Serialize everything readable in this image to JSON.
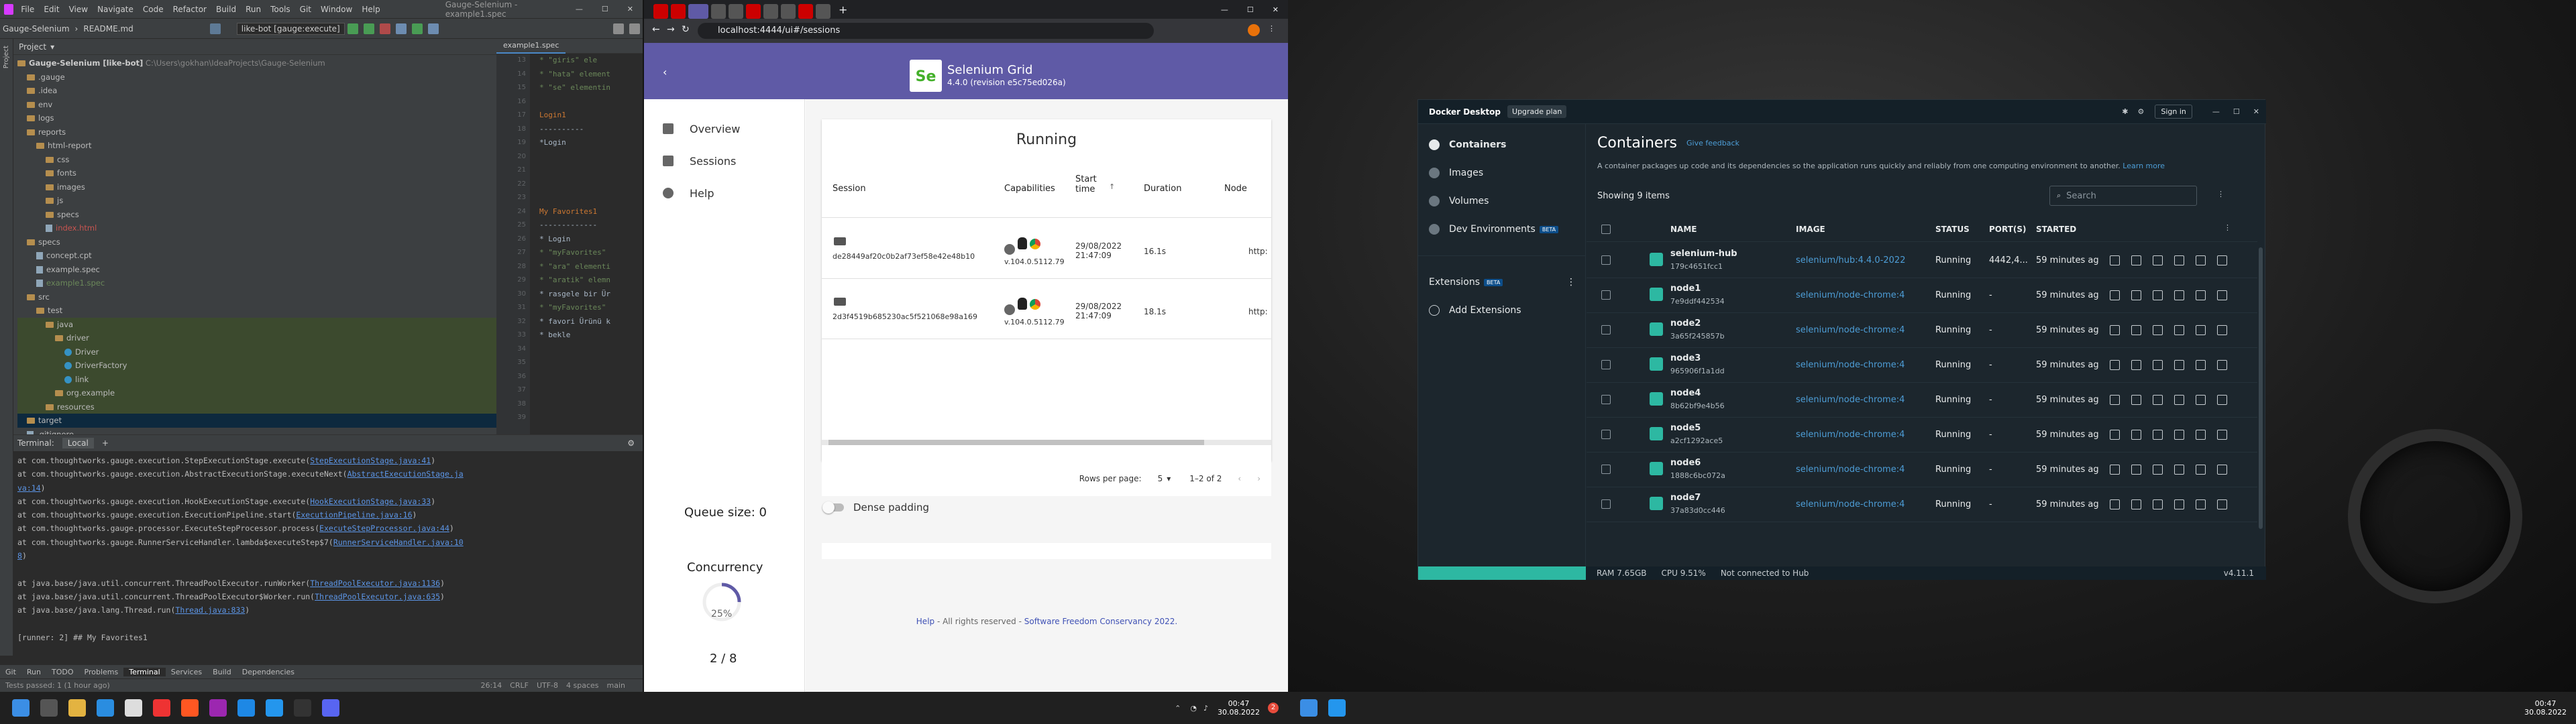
{
  "ide": {
    "app_title": "Gauge-Selenium - example1.spec",
    "menu": [
      "File",
      "Edit",
      "View",
      "Navigate",
      "Code",
      "Refactor",
      "Build",
      "Run",
      "Tools",
      "Git",
      "Window",
      "Help"
    ],
    "breadcrumb": [
      "Gauge-Selenium",
      "README.md"
    ],
    "run_config": "like-bot [gauge:execute]",
    "project_label": "Project",
    "root_label": "Gauge-Selenium [like-bot]",
    "root_path": "C:\\Users\\gokhan\\IdeaProjects\\Gauge-Selenium",
    "tree": [
      {
        "label": ".gauge",
        "type": "fold",
        "indent": 1
      },
      {
        "label": ".idea",
        "type": "fold",
        "indent": 1
      },
      {
        "label": "env",
        "type": "fold",
        "indent": 1
      },
      {
        "label": "logs",
        "type": "fold",
        "indent": 1
      },
      {
        "label": "reports",
        "type": "fold",
        "indent": 1
      },
      {
        "label": "html-report",
        "type": "fold",
        "indent": 2
      },
      {
        "label": "css",
        "type": "fold",
        "indent": 3
      },
      {
        "label": "fonts",
        "type": "fold",
        "indent": 3
      },
      {
        "label": "images",
        "type": "fold",
        "indent": 3
      },
      {
        "label": "js",
        "type": "fold",
        "indent": 3
      },
      {
        "label": "specs",
        "type": "fold",
        "indent": 3
      },
      {
        "label": "index.html",
        "type": "file",
        "indent": 3
      },
      {
        "label": "specs",
        "type": "fold",
        "indent": 1
      },
      {
        "label": "concept.cpt",
        "type": "file",
        "indent": 2
      },
      {
        "label": "example.spec",
        "type": "file",
        "indent": 2
      },
      {
        "label": "example1.spec",
        "type": "file",
        "indent": 2
      },
      {
        "label": "src",
        "type": "fold",
        "indent": 1
      },
      {
        "label": "test",
        "type": "fold",
        "indent": 2
      },
      {
        "label": "java",
        "type": "fold",
        "indent": 3,
        "hl": true
      },
      {
        "label": "driver",
        "type": "fold",
        "indent": 4,
        "hl": true
      },
      {
        "label": "Driver",
        "type": "cls",
        "indent": 5,
        "hl": true
      },
      {
        "label": "DriverFactory",
        "type": "cls",
        "indent": 5,
        "hl": true
      },
      {
        "label": "link",
        "type": "cls",
        "indent": 5,
        "hl": true
      },
      {
        "label": "org.example",
        "type": "fold",
        "indent": 4,
        "hl": true
      },
      {
        "label": "resources",
        "type": "fold",
        "indent": 3,
        "hl": true
      },
      {
        "label": "target",
        "type": "fold",
        "indent": 1,
        "sel": true
      },
      {
        "label": ".gitignore",
        "type": "file",
        "indent": 1
      }
    ],
    "editor_tab": "example1.spec",
    "gutter": [
      "13",
      "14",
      "15",
      "16",
      "17",
      "18",
      "19",
      "20",
      "21",
      "22",
      "23",
      "24",
      "25",
      "26",
      "27",
      "28",
      "29",
      "30",
      "31",
      "32",
      "33",
      "34",
      "35",
      "36",
      "37",
      "38",
      "39"
    ],
    "code": [
      {
        "t": "* \"giris\" ele",
        "c": "s"
      },
      {
        "t": "* \"hata\" element",
        "c": "s"
      },
      {
        "t": "* \"se\" elementin",
        "c": "s"
      },
      {
        "t": "",
        "c": ""
      },
      {
        "t": "Login1",
        "c": "h"
      },
      {
        "t": "----------",
        "c": ""
      },
      {
        "t": "*Login",
        "c": ""
      },
      {
        "t": "",
        "c": ""
      },
      {
        "t": "",
        "c": ""
      },
      {
        "t": "",
        "c": ""
      },
      {
        "t": "",
        "c": ""
      },
      {
        "t": "My Favorites1",
        "c": "h"
      },
      {
        "t": "-------------",
        "c": ""
      },
      {
        "t": "* Login",
        "c": ""
      },
      {
        "t": "* \"myFavorites\"",
        "c": "s"
      },
      {
        "t": "* \"ara\" elementi",
        "c": "s"
      },
      {
        "t": "* \"aratik\" elemn",
        "c": "s"
      },
      {
        "t": "* rasgele bir Ür",
        "c": ""
      },
      {
        "t": "* \"myFavorites\"",
        "c": "s"
      },
      {
        "t": "* favori Ürünü k",
        "c": ""
      },
      {
        "t": "* bekle",
        "c": ""
      }
    ],
    "terminal_tabs": [
      "Terminal:",
      "Local",
      "+"
    ],
    "terminal": [
      {
        "pre": "    at com.thoughtworks.gauge.execution.StepExecutionStage.execute(",
        "link": "StepExecutionStage.java:41",
        "post": ")"
      },
      {
        "pre": "    at com.thoughtworks.gauge.execution.AbstractExecutionStage.executeNext(",
        "link": "AbstractExecutionStage.ja",
        "post": ""
      },
      {
        "pre": "",
        "link": "va:14",
        "post": ")"
      },
      {
        "pre": "    at com.thoughtworks.gauge.execution.HookExecutionStage.execute(",
        "link": "HookExecutionStage.java:33",
        "post": ")"
      },
      {
        "pre": "    at com.thoughtworks.gauge.execution.ExecutionPipeline.start(",
        "link": "ExecutionPipeline.java:16",
        "post": ")"
      },
      {
        "pre": "    at com.thoughtworks.gauge.processor.ExecuteStepProcessor.process(",
        "link": "ExecuteStepProcessor.java:44",
        "post": ")"
      },
      {
        "pre": "    at com.thoughtworks.gauge.RunnerServiceHandler.lambda$executeStep$7(",
        "link": "RunnerServiceHandler.java:10",
        "post": ""
      },
      {
        "pre": "",
        "link": "8",
        "post": ")"
      },
      {
        "pre": "",
        "link": "",
        "post": ""
      },
      {
        "pre": "    at java.base/java.util.concurrent.ThreadPoolExecutor.runWorker(",
        "link": "ThreadPoolExecutor.java:1136",
        "post": ")"
      },
      {
        "pre": "    at java.base/java.util.concurrent.ThreadPoolExecutor$Worker.run(",
        "link": "ThreadPoolExecutor.java:635",
        "post": ")"
      },
      {
        "pre": "    at java.base/java.lang.Thread.run(",
        "link": "Thread.java:833",
        "post": ")"
      },
      {
        "pre": "",
        "link": "",
        "post": ""
      },
      {
        "pre": "[runner: 2]  ## My Favorites1",
        "link": "",
        "post": ""
      }
    ],
    "bottom_tabs": [
      "Git",
      "Run",
      "TODO",
      "Problems",
      "Terminal",
      "Services",
      "Build",
      "Dependencies"
    ],
    "status_left": "Tests passed: 1 (1 hour ago)",
    "status_right": [
      "26:14",
      "CRLF",
      "UTF-8",
      "4 spaces",
      "main"
    ]
  },
  "browser": {
    "url": "localhost:4444/ui#/sessions",
    "grid_title": "Selenium Grid",
    "grid_version": "4.4.0 (revision e5c75ed026a)",
    "nav": [
      "Overview",
      "Sessions",
      "Help"
    ],
    "running_title": "Running",
    "headers": [
      "Session",
      "Capabilities",
      "Start time",
      "Duration",
      "Node"
    ],
    "sessions": [
      {
        "id": "de28449af20c0b2af73ef58e42e48b10",
        "caps": "v.104.0.5112.79",
        "start": "29/08/2022 21:47:09",
        "duration": "16.1s",
        "node": "http:"
      },
      {
        "id": "2d3f4519b685230ac5f521068e98a169",
        "caps": "v.104.0.5112.79",
        "start": "29/08/2022 21:47:09",
        "duration": "18.1s",
        "node": "http:"
      }
    ],
    "rows_per_page_label": "Rows per page:",
    "rows_per_page": "5",
    "range": "1–2 of 2",
    "dense_label": "Dense padding",
    "queue": "Queue size: 0",
    "concurrency_label": "Concurrency",
    "concurrency_pct": "25%",
    "concurrency_value": 0.25,
    "concurrency_count": "2 / 8",
    "footer_help": "Help",
    "footer_mid": " - All rights reserved - ",
    "footer_org": "Software Freedom Conservancy 2022."
  },
  "docker": {
    "brand": "Docker Desktop",
    "upgrade": "Upgrade plan",
    "sign_in": "Sign in",
    "nav": [
      "Containers",
      "Images",
      "Volumes",
      "Dev Environments"
    ],
    "beta": "BETA",
    "extensions": "Extensions",
    "add_ext": "Add Extensions",
    "title": "Containers",
    "feedback": "Give feedback",
    "desc": "A container packages up code and its dependencies so the application runs quickly and reliably from one computing environment to another.",
    "learn_more": "Learn more",
    "showing": "Showing 9 items",
    "search_placeholder": "Search",
    "cols": [
      "NAME",
      "IMAGE",
      "STATUS",
      "PORT(S)",
      "STARTED"
    ],
    "rows": [
      {
        "name": "selenium-hub",
        "id": "179c4651fcc1",
        "image": "selenium/hub:4.4.0-2022",
        "status": "Running",
        "ports": "4442,4...",
        "started": "59 minutes ag"
      },
      {
        "name": "node1",
        "id": "7e9ddf442534",
        "image": "selenium/node-chrome:4",
        "status": "Running",
        "ports": "-",
        "started": "59 minutes ag"
      },
      {
        "name": "node2",
        "id": "3a65f245857b",
        "image": "selenium/node-chrome:4",
        "status": "Running",
        "ports": "-",
        "started": "59 minutes ag"
      },
      {
        "name": "node3",
        "id": "965906f1a1dd",
        "image": "selenium/node-chrome:4",
        "status": "Running",
        "ports": "-",
        "started": "59 minutes ag"
      },
      {
        "name": "node4",
        "id": "8b62bf9e4b56",
        "image": "selenium/node-chrome:4",
        "status": "Running",
        "ports": "-",
        "started": "59 minutes ag"
      },
      {
        "name": "node5",
        "id": "a2cf1292ace5",
        "image": "selenium/node-chrome:4",
        "status": "Running",
        "ports": "-",
        "started": "59 minutes ag"
      },
      {
        "name": "node6",
        "id": "1888c6bc072a",
        "image": "selenium/node-chrome:4",
        "status": "Running",
        "ports": "-",
        "started": "59 minutes ag"
      },
      {
        "name": "node7",
        "id": "37a83d0cc446",
        "image": "selenium/node-chrome:4",
        "status": "Running",
        "ports": "-",
        "started": "59 minutes ag"
      }
    ],
    "ram": "RAM 7.65GB",
    "cpu": "CPU 9.51%",
    "hub": "Not connected to Hub",
    "version": "v4.11.1"
  },
  "taskbar": {
    "time": "00:47",
    "date": "30.08.2022",
    "time2": "00:47",
    "date2": "30.08.2022",
    "badge": "2"
  },
  "colors": {
    "ide_bg": "#2b2b2b",
    "grid_purple": "#5f5aa6",
    "docker_bg": "#1c262d",
    "docker_accent": "#2db8a2",
    "link_blue": "#4d9dd6"
  }
}
